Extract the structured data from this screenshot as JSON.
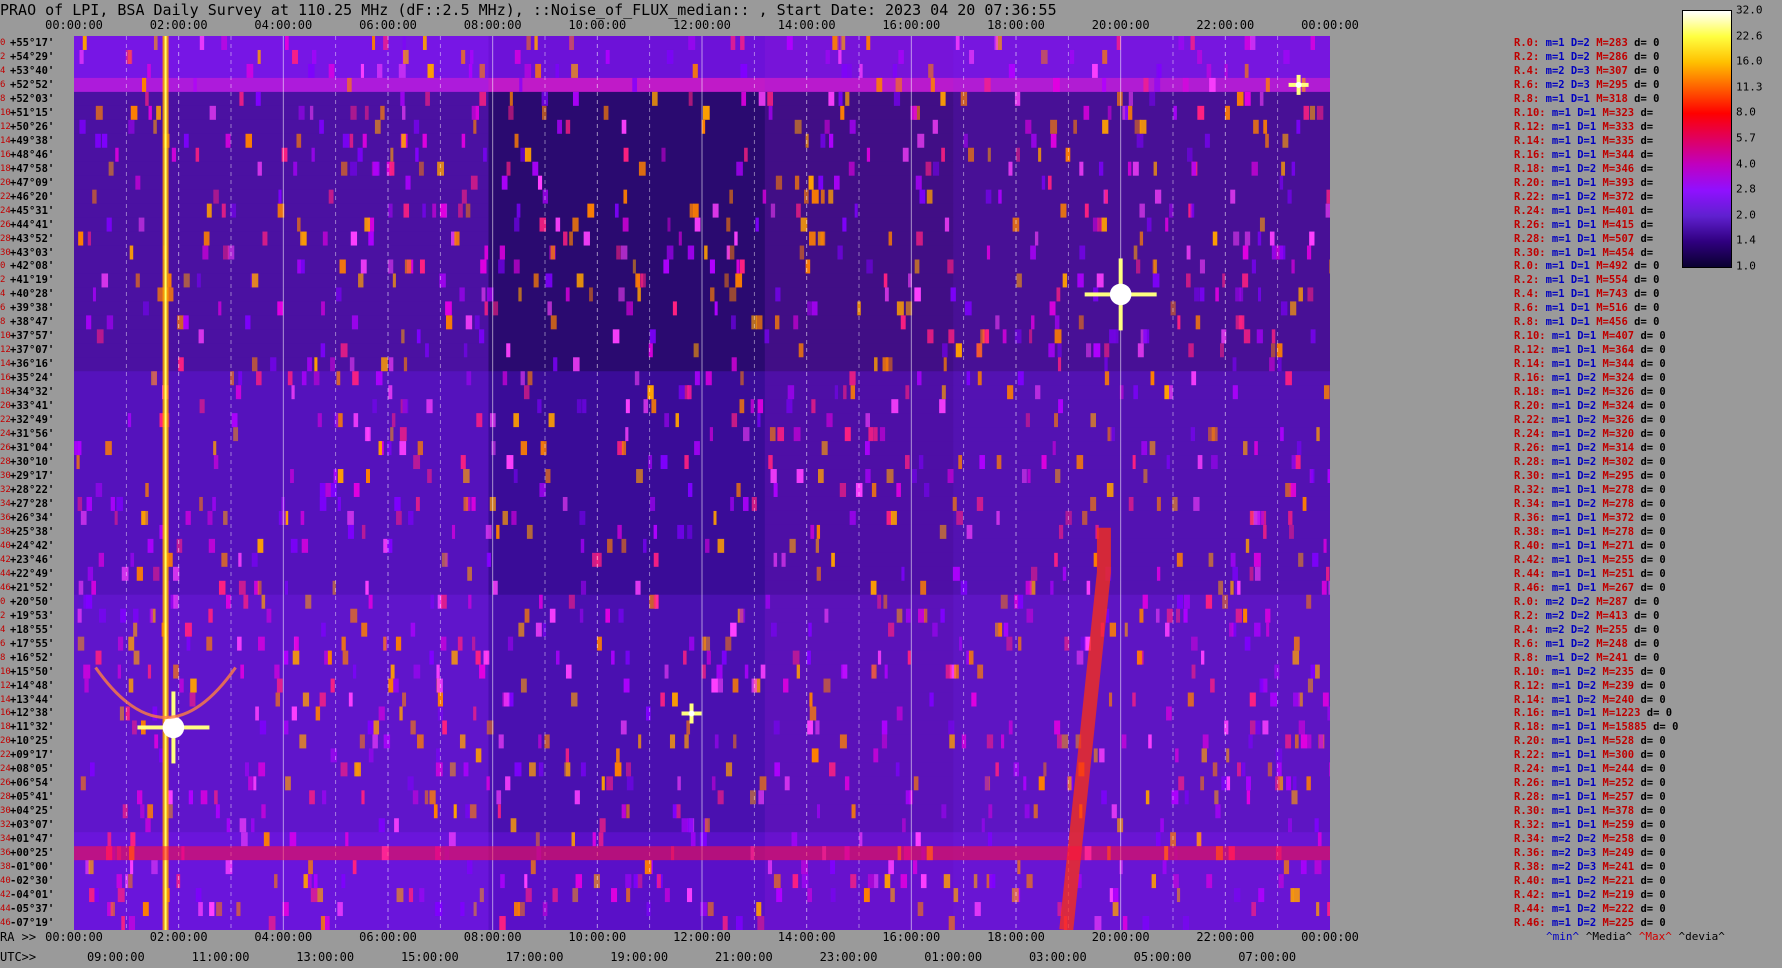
{
  "title": "PRAO of LPI, BSA Daily Survey at 110.25 MHz (dF::2.5 MHz), ::Noise_of_FLUX_median:: , Start Date: 2023 04 20 07:36:55",
  "ra_top_ticks": [
    "00:00:00",
    "02:00:00",
    "04:00:00",
    "06:00:00",
    "08:00:00",
    "10:00:00",
    "12:00:00",
    "14:00:00",
    "16:00:00",
    "18:00:00",
    "20:00:00",
    "22:00:00",
    "00:00:00"
  ],
  "ra_bottom_prefix": "RA >>",
  "ra_bottom_ticks": [
    "00:00:00",
    "02:00:00",
    "04:00:00",
    "06:00:00",
    "08:00:00",
    "10:00:00",
    "12:00:00",
    "14:00:00",
    "16:00:00",
    "18:00:00",
    "20:00:00",
    "22:00:00",
    "00:00:00"
  ],
  "utc_prefix": "UTC>>",
  "utc_ticks": [
    "09:00:00",
    "11:00:00",
    "13:00:00",
    "15:00:00",
    "17:00:00",
    "19:00:00",
    "21:00:00",
    "23:00:00",
    "01:00:00",
    "03:00:00",
    "05:00:00",
    "07:00:00"
  ],
  "declinations": [
    "+55°17'",
    "+54°29'",
    "+53°40'",
    "+52°52'",
    "+52°03'",
    "+51°15'",
    "+50°26'",
    "+49°38'",
    "+48°46'",
    "+47°58'",
    "+47°09'",
    "+46°20'",
    "+45°31'",
    "+44°41'",
    "+43°52'",
    "+43°03'",
    "+42°08'",
    "+41°19'",
    "+40°28'",
    "+39°38'",
    "+38°47'",
    "+37°57'",
    "+37°07'",
    "+36°16'",
    "+35°24'",
    "+34°32'",
    "+33°41'",
    "+32°49'",
    "+31°56'",
    "+31°04'",
    "+30°10'",
    "+29°17'",
    "+28°22'",
    "+27°28'",
    "+26°34'",
    "+25°38'",
    "+24°42'",
    "+23°46'",
    "+22°49'",
    "+21°52'",
    "+20°50'",
    "+19°53'",
    "+18°55'",
    "+17°55'",
    "+16°52'",
    "+15°50'",
    "+14°48'",
    "+13°44'",
    "+12°38'",
    "+11°32'",
    "+10°25'",
    "+09°17'",
    "+08°05'",
    "+06°54'",
    "+05°41'",
    "+04°25'",
    "+03°07'",
    "+01°47'",
    "+00°25'",
    "-01°00'",
    "-02°30'",
    "-04°01'",
    "-05°37'",
    "-07°19'"
  ],
  "beam_numbers": [
    "0",
    "2",
    "4",
    "6",
    "8",
    "10",
    "12",
    "14",
    "16",
    "18",
    "20",
    "22",
    "24",
    "26",
    "28",
    "30",
    "0",
    "2",
    "4",
    "6",
    "8",
    "10",
    "12",
    "14",
    "16",
    "18",
    "20",
    "22",
    "24",
    "26",
    "28",
    "30",
    "32",
    "34",
    "36",
    "38",
    "40",
    "42",
    "44",
    "46",
    "0",
    "2",
    "4",
    "6",
    "8",
    "10",
    "12",
    "14",
    "16",
    "18",
    "20",
    "22",
    "24",
    "26",
    "28",
    "30",
    "32",
    "34",
    "36",
    "38",
    "40",
    "42",
    "44",
    "46"
  ],
  "right_rows": [
    {
      "r": "R.0:",
      "m": "m=1",
      "D": "D=2",
      "M": "M=283",
      "d": "d= 0"
    },
    {
      "r": "R.2:",
      "m": "m=1",
      "D": "D=2",
      "M": "M=286",
      "d": "d= 0"
    },
    {
      "r": "R.4:",
      "m": "m=2",
      "D": "D=3",
      "M": "M=307",
      "d": "d= 0"
    },
    {
      "r": "R.6:",
      "m": "m=2",
      "D": "D=3",
      "M": "M=295",
      "d": "d= 0"
    },
    {
      "r": "R.8:",
      "m": "m=1",
      "D": "D=1",
      "M": "M=318",
      "d": "d= 0"
    },
    {
      "r": "R.10:",
      "m": "m=1",
      "D": "D=1",
      "M": "M=323",
      "d": "d="
    },
    {
      "r": "R.12:",
      "m": "m=1",
      "D": "D=1",
      "M": "M=333",
      "d": "d="
    },
    {
      "r": "R.14:",
      "m": "m=1",
      "D": "D=1",
      "M": "M=335",
      "d": "d="
    },
    {
      "r": "R.16:",
      "m": "m=1",
      "D": "D=1",
      "M": "M=344",
      "d": "d="
    },
    {
      "r": "R.18:",
      "m": "m=1",
      "D": "D=2",
      "M": "M=346",
      "d": "d="
    },
    {
      "r": "R.20:",
      "m": "m=1",
      "D": "D=1",
      "M": "M=393",
      "d": "d="
    },
    {
      "r": "R.22:",
      "m": "m=1",
      "D": "D=2",
      "M": "M=372",
      "d": "d="
    },
    {
      "r": "R.24:",
      "m": "m=1",
      "D": "D=1",
      "M": "M=401",
      "d": "d="
    },
    {
      "r": "R.26:",
      "m": "m=1",
      "D": "D=1",
      "M": "M=415",
      "d": "d="
    },
    {
      "r": "R.28:",
      "m": "m=1",
      "D": "D=1",
      "M": "M=507",
      "d": "d="
    },
    {
      "r": "R.30:",
      "m": "m=1",
      "D": "D=1",
      "M": "M=454",
      "d": "d="
    },
    {
      "r": "R.0:",
      "m": "m=1",
      "D": "D=1",
      "M": "M=492",
      "d": "d= 0"
    },
    {
      "r": "R.2:",
      "m": "m=1",
      "D": "D=1",
      "M": "M=554",
      "d": "d= 0"
    },
    {
      "r": "R.4:",
      "m": "m=1",
      "D": "D=1",
      "M": "M=743",
      "d": "d= 0"
    },
    {
      "r": "R.6:",
      "m": "m=1",
      "D": "D=1",
      "M": "M=516",
      "d": "d= 0"
    },
    {
      "r": "R.8:",
      "m": "m=1",
      "D": "D=1",
      "M": "M=456",
      "d": "d= 0"
    },
    {
      "r": "R.10:",
      "m": "m=1",
      "D": "D=1",
      "M": "M=407",
      "d": "d= 0"
    },
    {
      "r": "R.12:",
      "m": "m=1",
      "D": "D=1",
      "M": "M=364",
      "d": "d= 0"
    },
    {
      "r": "R.14:",
      "m": "m=1",
      "D": "D=1",
      "M": "M=344",
      "d": "d= 0"
    },
    {
      "r": "R.16:",
      "m": "m=1",
      "D": "D=2",
      "M": "M=324",
      "d": "d= 0"
    },
    {
      "r": "R.18:",
      "m": "m=1",
      "D": "D=2",
      "M": "M=326",
      "d": "d= 0"
    },
    {
      "r": "R.20:",
      "m": "m=1",
      "D": "D=2",
      "M": "M=324",
      "d": "d= 0"
    },
    {
      "r": "R.22:",
      "m": "m=1",
      "D": "D=2",
      "M": "M=326",
      "d": "d= 0"
    },
    {
      "r": "R.24:",
      "m": "m=1",
      "D": "D=2",
      "M": "M=320",
      "d": "d= 0"
    },
    {
      "r": "R.26:",
      "m": "m=1",
      "D": "D=2",
      "M": "M=314",
      "d": "d= 0"
    },
    {
      "r": "R.28:",
      "m": "m=1",
      "D": "D=2",
      "M": "M=302",
      "d": "d= 0"
    },
    {
      "r": "R.30:",
      "m": "m=1",
      "D": "D=2",
      "M": "M=295",
      "d": "d= 0"
    },
    {
      "r": "R.32:",
      "m": "m=1",
      "D": "D=1",
      "M": "M=278",
      "d": "d= 0"
    },
    {
      "r": "R.34:",
      "m": "m=1",
      "D": "D=2",
      "M": "M=278",
      "d": "d= 0"
    },
    {
      "r": "R.36:",
      "m": "m=1",
      "D": "D=1",
      "M": "M=372",
      "d": "d= 0"
    },
    {
      "r": "R.38:",
      "m": "m=1",
      "D": "D=1",
      "M": "M=278",
      "d": "d= 0"
    },
    {
      "r": "R.40:",
      "m": "m=1",
      "D": "D=1",
      "M": "M=271",
      "d": "d= 0"
    },
    {
      "r": "R.42:",
      "m": "m=1",
      "D": "D=1",
      "M": "M=255",
      "d": "d= 0"
    },
    {
      "r": "R.44:",
      "m": "m=1",
      "D": "D=1",
      "M": "M=251",
      "d": "d= 0"
    },
    {
      "r": "R.46:",
      "m": "m=1",
      "D": "D=1",
      "M": "M=267",
      "d": "d= 0"
    },
    {
      "r": "R.0:",
      "m": "m=2",
      "D": "D=2",
      "M": "M=287",
      "d": "d= 0"
    },
    {
      "r": "R.2:",
      "m": "m=2",
      "D": "D=2",
      "M": "M=413",
      "d": "d= 0"
    },
    {
      "r": "R.4:",
      "m": "m=2",
      "D": "D=2",
      "M": "M=255",
      "d": "d= 0"
    },
    {
      "r": "R.6:",
      "m": "m=1",
      "D": "D=2",
      "M": "M=248",
      "d": "d= 0"
    },
    {
      "r": "R.8:",
      "m": "m=1",
      "D": "D=2",
      "M": "M=241",
      "d": "d= 0"
    },
    {
      "r": "R.10:",
      "m": "m=1",
      "D": "D=2",
      "M": "M=235",
      "d": "d= 0"
    },
    {
      "r": "R.12:",
      "m": "m=1",
      "D": "D=2",
      "M": "M=239",
      "d": "d= 0"
    },
    {
      "r": "R.14:",
      "m": "m=1",
      "D": "D=2",
      "M": "M=240",
      "d": "d= 0"
    },
    {
      "r": "R.16:",
      "m": "m=1",
      "D": "D=1",
      "M": "M=1223",
      "d": "d= 0"
    },
    {
      "r": "R.18:",
      "m": "m=1",
      "D": "D=1",
      "M": "M=15885",
      "d": "d= 0"
    },
    {
      "r": "R.20:",
      "m": "m=1",
      "D": "D=1",
      "M": "M=528",
      "d": "d= 0"
    },
    {
      "r": "R.22:",
      "m": "m=1",
      "D": "D=1",
      "M": "M=300",
      "d": "d= 0"
    },
    {
      "r": "R.24:",
      "m": "m=1",
      "D": "D=1",
      "M": "M=244",
      "d": "d= 0"
    },
    {
      "r": "R.26:",
      "m": "m=1",
      "D": "D=1",
      "M": "M=252",
      "d": "d= 0"
    },
    {
      "r": "R.28:",
      "m": "m=1",
      "D": "D=1",
      "M": "M=257",
      "d": "d= 0"
    },
    {
      "r": "R.30:",
      "m": "m=1",
      "D": "D=1",
      "M": "M=378",
      "d": "d= 0"
    },
    {
      "r": "R.32:",
      "m": "m=1",
      "D": "D=1",
      "M": "M=259",
      "d": "d= 0"
    },
    {
      "r": "R.34:",
      "m": "m=2",
      "D": "D=2",
      "M": "M=258",
      "d": "d= 0"
    },
    {
      "r": "R.36:",
      "m": "m=2",
      "D": "D=3",
      "M": "M=249",
      "d": "d= 0"
    },
    {
      "r": "R.38:",
      "m": "m=2",
      "D": "D=3",
      "M": "M=241",
      "d": "d= 0"
    },
    {
      "r": "R.40:",
      "m": "m=1",
      "D": "D=2",
      "M": "M=221",
      "d": "d= 0"
    },
    {
      "r": "R.42:",
      "m": "m=1",
      "D": "D=2",
      "M": "M=219",
      "d": "d= 0"
    },
    {
      "r": "R.44:",
      "m": "m=1",
      "D": "D=2",
      "M": "M=222",
      "d": "d= 0"
    },
    {
      "r": "R.46:",
      "m": "m=1",
      "D": "D=2",
      "M": "M=225",
      "d": "d= 0"
    }
  ],
  "colorbar": {
    "ticks": [
      "32.0",
      "22.6",
      "16.0",
      "11.3",
      "8.0",
      "5.7",
      "4.0",
      "2.8",
      "2.0",
      "1.4",
      "1.0"
    ],
    "colors": [
      "#ffffff",
      "#ffff40",
      "#ffc000",
      "#ff6000",
      "#ff0000",
      "#e00060",
      "#c000c0",
      "#9010ff",
      "#6020d0",
      "#300080",
      "#0a0030"
    ]
  },
  "legend": {
    "min": "^min^",
    "median": "^Media^",
    "max": "^Max^",
    "devia": "^devia^"
  },
  "chart_data": {
    "type": "heatmap",
    "title": "PRAO of LPI, BSA Daily Survey at 110.25 MHz (dF::2.5 MHz), ::Noise_of_FLUX_median:: , Start Date: 2023 04 20 07:36:55",
    "xlabel": "RA",
    "x_range_hours": [
      0,
      24
    ],
    "y_range_dec": [
      "+55°17'",
      "-07°19'"
    ],
    "color_scale": "log",
    "color_range": [
      1.0,
      32.0
    ],
    "bright_sources": [
      {
        "ra_hours": 1.9,
        "dec": "+11°32'",
        "value": 32.0
      },
      {
        "ra_hours": 20.0,
        "dec": "+40°28'",
        "value": 32.0
      },
      {
        "ra_hours": 11.8,
        "dec": "+12°38'",
        "value": 16.0
      },
      {
        "ra_hours": 23.4,
        "dec": "+52°52'",
        "value": 16.0
      }
    ]
  }
}
